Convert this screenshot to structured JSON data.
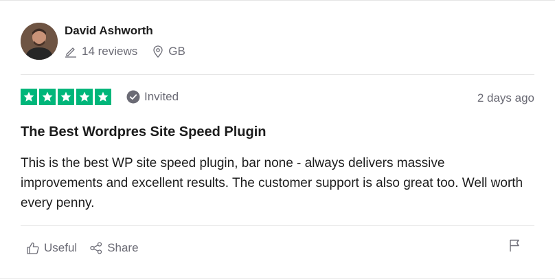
{
  "reviewer": {
    "name": "David Ashworth",
    "reviews_count": "14 reviews",
    "country": "GB"
  },
  "review": {
    "rating": 5,
    "invited_label": "Invited",
    "date": "2 days ago",
    "title": "The Best Wordpres Site Speed Plugin",
    "body": "This is the best WP site speed plugin, bar none - always delivers massive improvements and excellent results. The customer support is also great too. Well worth every penny."
  },
  "actions": {
    "useful_label": "Useful",
    "share_label": "Share"
  },
  "colors": {
    "star_green": "#00b67a",
    "muted_text": "#6b6b75"
  },
  "icons": [
    "avatar",
    "pencil-icon",
    "location-pin-icon",
    "star-icon",
    "verified-check-icon",
    "thumbs-up-icon",
    "share-icon",
    "flag-icon"
  ]
}
